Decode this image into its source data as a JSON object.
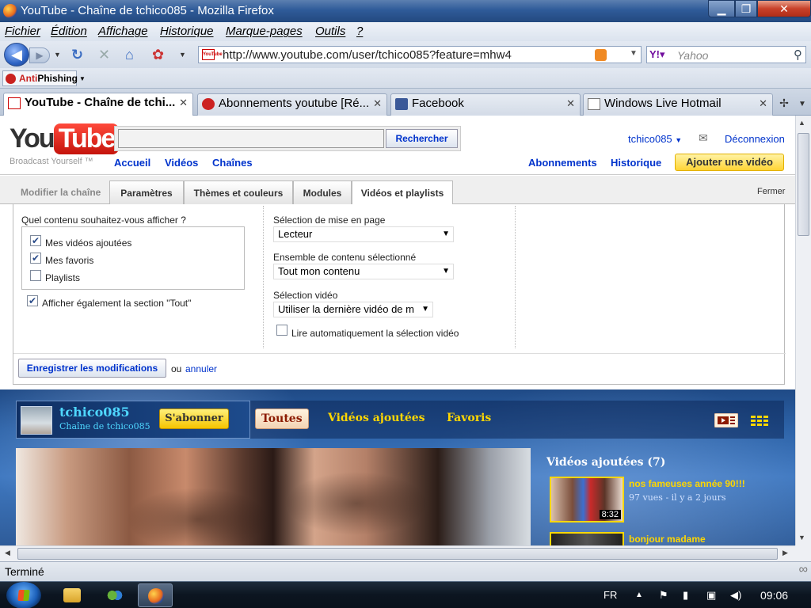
{
  "window": {
    "title": "YouTube - Chaîne de tchico085 - Mozilla Firefox",
    "min": "▁",
    "max": "❐",
    "close": "✕"
  },
  "menu": [
    "Fichier",
    "Édition",
    "Affichage",
    "Historique",
    "Marque-pages",
    "Outils",
    "?"
  ],
  "nav": {
    "url": "http://www.youtube.com/user/tchico085?feature=mhw4",
    "search_placeholder": "Yahoo",
    "url_favicon_text": "YouTube"
  },
  "toolbar2": {
    "antiphishing_prefix": "Anti",
    "antiphishing_label": "Phishing"
  },
  "tabs": [
    {
      "label": "YouTube - Chaîne de tchi...",
      "active": true
    },
    {
      "label": "Abonnements youtube [Ré...",
      "active": false
    },
    {
      "label": "Facebook",
      "active": false
    },
    {
      "label": "Windows Live Hotmail",
      "active": false
    }
  ],
  "youtube": {
    "logo_you": "You",
    "logo_tube": "Tube",
    "tagline": "Broadcast Yourself ™",
    "search_button": "Rechercher",
    "nav_left": [
      "Accueil",
      "Vidéos",
      "Chaînes"
    ],
    "user": "tchico085",
    "logout": "Déconnexion",
    "nav_right": [
      "Abonnements",
      "Historique"
    ],
    "upload": "Ajouter une vidéo"
  },
  "edit": {
    "label": "Modifier la chaîne",
    "tabs": [
      "Paramètres",
      "Thèmes et couleurs",
      "Modules",
      "Vidéos et playlists"
    ],
    "active_tab": "Vidéos et playlists",
    "close": "Fermer",
    "content_question": "Quel contenu souhaitez-vous afficher ?",
    "content_options": [
      {
        "label": "Mes vidéos ajoutées",
        "checked": true
      },
      {
        "label": "Mes favoris",
        "checked": true
      },
      {
        "label": "Playlists",
        "checked": false
      }
    ],
    "show_all": {
      "label": "Afficher également la section \"Tout\"",
      "checked": true
    },
    "layout_label": "Sélection de mise en page",
    "layout_value": "Lecteur",
    "content_set_label": "Ensemble de contenu sélectionné",
    "content_set_value": "Tout mon contenu",
    "video_label": "Sélection vidéo",
    "video_value": "Utiliser la dernière vidéo de m",
    "autoplay": {
      "label": "Lire automatiquement la sélection vidéo",
      "checked": false
    },
    "save": "Enregistrer les modifications",
    "or": "ou",
    "cancel": "annuler"
  },
  "channel": {
    "name": "tchico085",
    "subtitle": "Chaîne de tchico085",
    "subscribe": "S'abonner",
    "tabs": [
      "Toutes",
      "Vidéos ajoutées",
      "Favoris"
    ],
    "active_tab": "Toutes",
    "section_title": "Vidéos ajoutées (7)",
    "videos": [
      {
        "title": "nos fameuses année 90!!!",
        "meta": "97 vues - il y a 2 jours",
        "duration": "8:32"
      },
      {
        "title": "bonjour madame",
        "meta": "",
        "duration": ""
      }
    ]
  },
  "status": {
    "text": "Terminé",
    "icon": "∞"
  },
  "taskbar": {
    "lang": "FR",
    "time": "09:06"
  }
}
